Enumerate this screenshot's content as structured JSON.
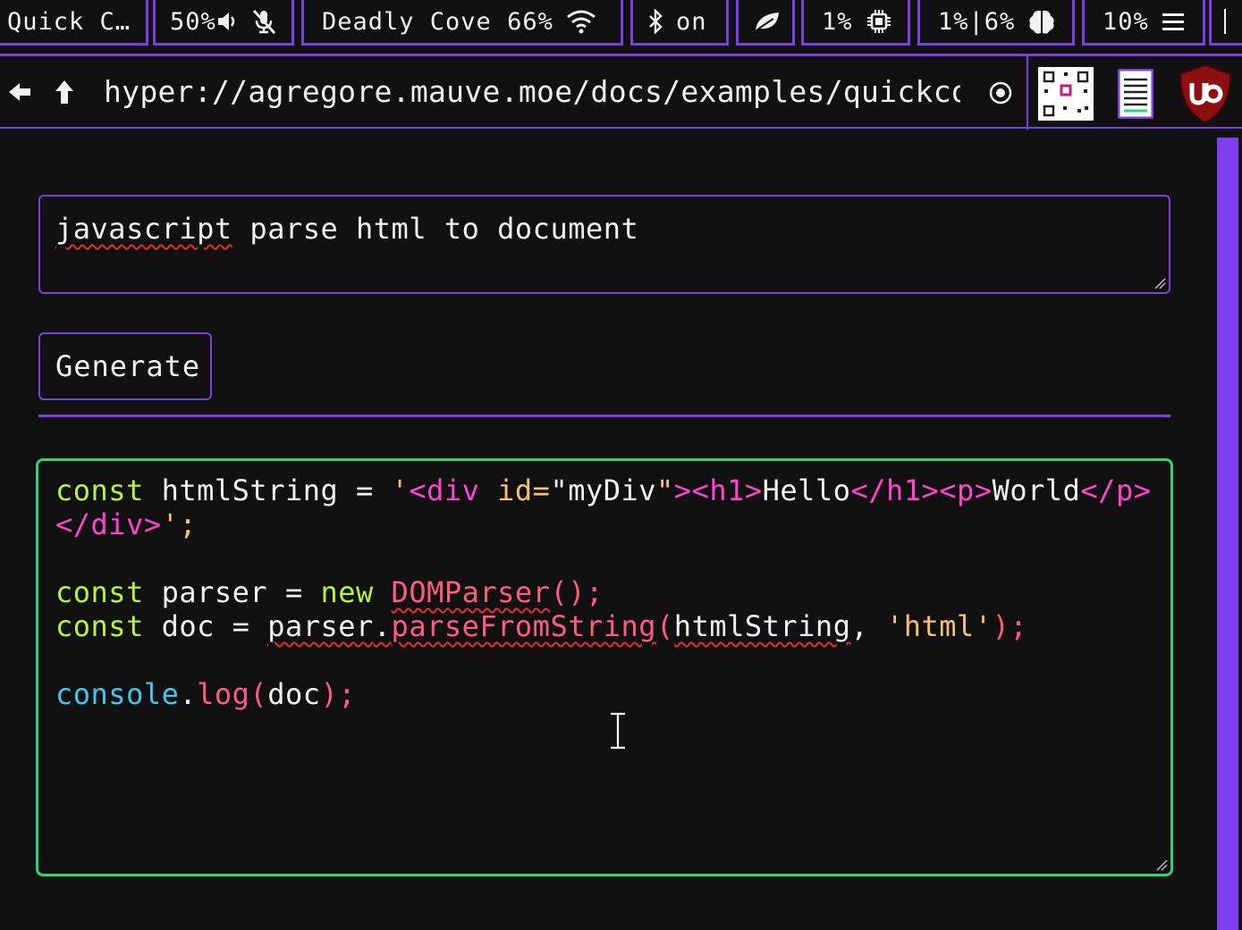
{
  "statusbar": {
    "title": "Quick C…",
    "volume": "50%",
    "network": "Deadly Cove 66%",
    "bluetooth": "on",
    "cpu": "1%",
    "memory": "1%|6%",
    "disk": "10%"
  },
  "addressbar": {
    "url": "hyper://agregore.mauve.moe/docs/examples/quickcode.html"
  },
  "prompt": {
    "value": "javascript parse html to document"
  },
  "generate_label": "Generate",
  "code": {
    "lines": [
      "const htmlString = '<div id=\"myDiv\"><h1>Hello</h1><p>World</p></div>';",
      "",
      "const parser = new DOMParser();",
      "const doc = parser.parseFromString(htmlString, 'html');",
      "",
      "console.log(doc);"
    ]
  },
  "colors": {
    "accent": "#7b3fe0",
    "code_border": "#2fd277",
    "background": "#111111",
    "keyword": "#b7f53b",
    "string": "#f6c176",
    "tag": "#ff45d0",
    "function": "#ff5a82",
    "object": "#3fc7ef"
  },
  "icons": [
    "speaker-icon",
    "mic-muted-icon",
    "wifi-icon",
    "bluetooth-icon",
    "leaf-icon",
    "cpu-chip-icon",
    "brain-icon",
    "menu-icon",
    "back-arrow-icon",
    "up-arrow-icon",
    "target-icon",
    "qr-code-icon",
    "notes-icon",
    "ublock-icon"
  ]
}
